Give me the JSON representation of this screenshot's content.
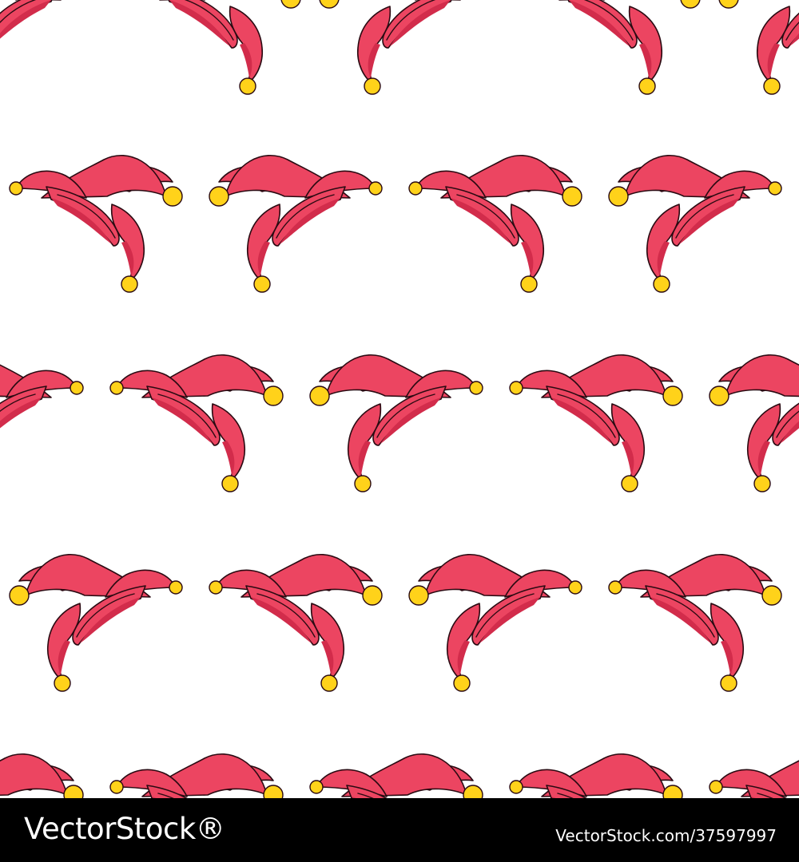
{
  "pattern": {
    "motif_icon": "jester-hat-icon",
    "colors": {
      "hat_fill": "#ec4561",
      "hat_shadow": "#d22c4b",
      "outline": "#2a0a12",
      "bell_fill": "#ffd21a",
      "background": "#ffffff"
    }
  },
  "footer": {
    "brand_text": "VectorStock®",
    "image_id_text": "VectorStock.com/37597997",
    "background_color": "#000000",
    "text_color": "#ffffff"
  }
}
